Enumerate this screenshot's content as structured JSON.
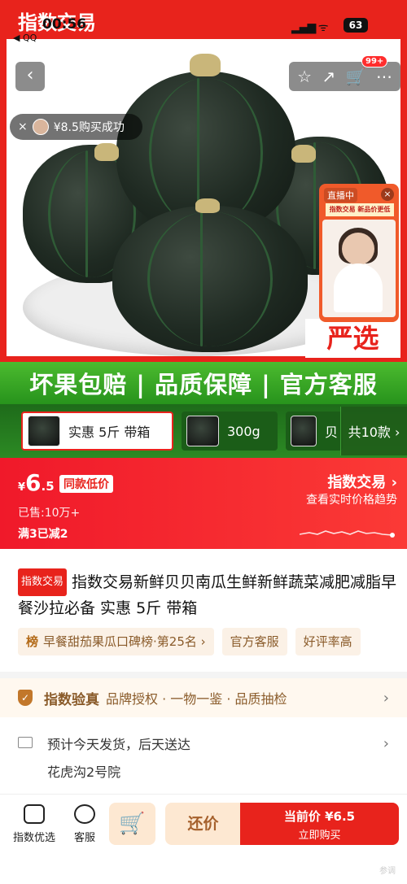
{
  "status_bar": {
    "time": "00:56",
    "back_app": "◀ QQ",
    "signal": "▂▄▆ ᯤ",
    "battery": "63"
  },
  "brand_tag": "指数交易",
  "header": {
    "back": "‹",
    "icons": [
      "☆",
      "↗",
      "🛒",
      "⋯"
    ],
    "cart_badge": "99+"
  },
  "toast": {
    "close": "×",
    "text": "¥8.5购买成功"
  },
  "live": {
    "label": "直播中",
    "close": "×",
    "banner": "指数交易 新品价更低"
  },
  "yanxuan": "严选",
  "guarantee": "坏果包赔 | 品质保障 | 官方客服",
  "variants": [
    {
      "label": "实惠 5斤 带箱"
    },
    {
      "label": "300g"
    },
    {
      "label": "贝"
    }
  ],
  "variants_more": "共10款 ›",
  "price": {
    "currency": "¥",
    "integer": "6",
    "decimal": ".5",
    "tag": "同款低价",
    "sold": "已售:10万+",
    "promo": "满3已减2",
    "index_title": "指数交易 ›",
    "index_sub": "查看实时价格趋势"
  },
  "product": {
    "tag": "指数交易",
    "title": "指数交易新鲜贝贝南瓜生鲜新鲜蔬菜减肥减脂早餐沙拉必备 实惠 5斤 带箱"
  },
  "pills": [
    {
      "icon": "榜",
      "text": "早餐甜茄果瓜口碑榜·第25名 ›"
    },
    {
      "icon": "",
      "text": "官方客服"
    },
    {
      "icon": "",
      "text": "好评率高"
    }
  ],
  "verify": {
    "title": "指数验真",
    "text": "品牌授权 · 一物一鉴 · 品质抽检",
    "chev": "›"
  },
  "shipping": {
    "line1": "预计今天发货，后天送达",
    "line2": "花虎沟2号院",
    "chev": "›"
  },
  "bottom": {
    "tab1": "指数优选",
    "tab2": "客服",
    "cart": "🛒",
    "bargain": "还价",
    "buy_price": "当前价 ¥6.5",
    "buy_label": "立即购买"
  },
  "watermark": "参调"
}
